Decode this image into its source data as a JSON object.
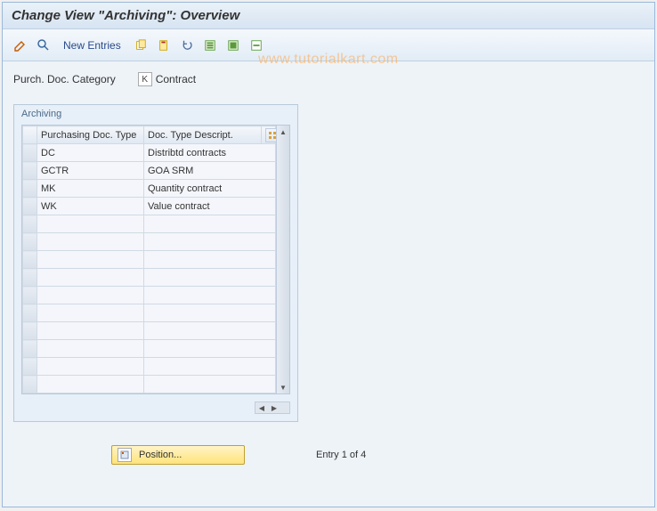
{
  "window": {
    "title": "Change View \"Archiving\": Overview"
  },
  "toolbar": {
    "new_entries_label": "New Entries"
  },
  "category": {
    "label": "Purch. Doc. Category",
    "code": "K",
    "text": "Contract"
  },
  "panel": {
    "title": "Archiving"
  },
  "columns": {
    "type": "Purchasing Doc. Type",
    "desc": "Doc. Type Descript."
  },
  "rows": [
    {
      "type": "DC",
      "desc": "Distribtd contracts"
    },
    {
      "type": "GCTR",
      "desc": "GOA SRM"
    },
    {
      "type": "MK",
      "desc": "Quantity contract"
    },
    {
      "type": "WK",
      "desc": "Value contract"
    },
    {
      "type": "",
      "desc": ""
    },
    {
      "type": "",
      "desc": ""
    },
    {
      "type": "",
      "desc": ""
    },
    {
      "type": "",
      "desc": ""
    },
    {
      "type": "",
      "desc": ""
    },
    {
      "type": "",
      "desc": ""
    },
    {
      "type": "",
      "desc": ""
    },
    {
      "type": "",
      "desc": ""
    },
    {
      "type": "",
      "desc": ""
    },
    {
      "type": "",
      "desc": ""
    }
  ],
  "footer": {
    "position_label": "Position...",
    "entry_label": "Entry 1 of 4"
  },
  "watermark": "www.tutorialkart.com"
}
